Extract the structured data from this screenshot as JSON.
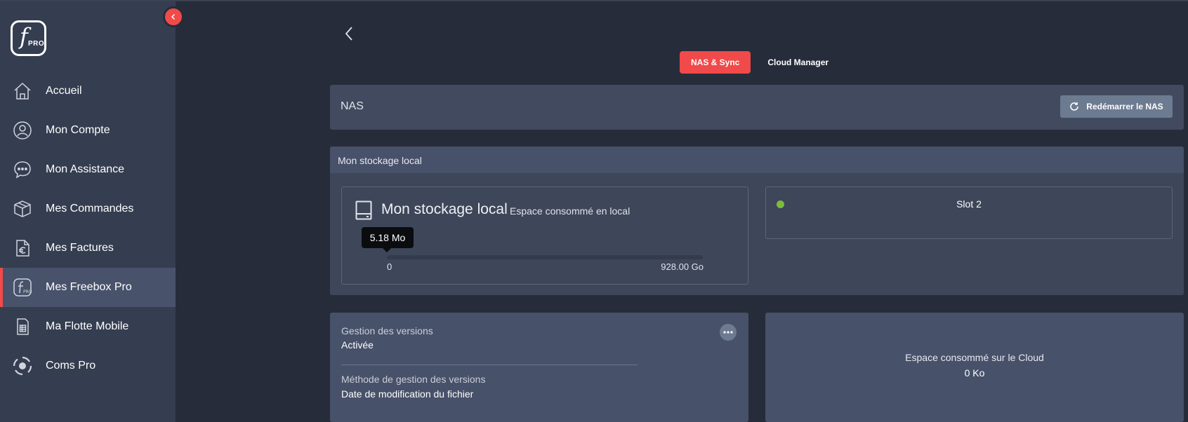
{
  "sidebar": {
    "logo": {
      "letter": "f",
      "sub": "PRO"
    },
    "items": [
      {
        "label": "Accueil",
        "icon": "home-icon",
        "active": false
      },
      {
        "label": "Mon Compte",
        "icon": "user-icon",
        "active": false
      },
      {
        "label": "Mon Assistance",
        "icon": "chat-icon",
        "active": false
      },
      {
        "label": "Mes Commandes",
        "icon": "box-icon",
        "active": false
      },
      {
        "label": "Mes Factures",
        "icon": "euro-document-icon",
        "active": false
      },
      {
        "label": "Mes Freebox Pro",
        "icon": "freebox-pro-icon",
        "active": true
      },
      {
        "label": "Ma Flotte Mobile",
        "icon": "sim-card-icon",
        "active": false
      },
      {
        "label": "Coms Pro",
        "icon": "coms-icon",
        "active": false
      }
    ]
  },
  "tabs": [
    {
      "label": "NAS & Sync",
      "active": true
    },
    {
      "label": "Cloud Manager",
      "active": false
    }
  ],
  "nas": {
    "title": "NAS",
    "restart_label": "Redémarrer le NAS"
  },
  "storage": {
    "header": "Mon stockage local",
    "local": {
      "title": "Mon stockage local",
      "subtitle": "Espace consommé en local",
      "used": "5.18 Mo",
      "used_fraction": 0.0,
      "min": "0",
      "max": "928.00 Go"
    },
    "slot": {
      "label": "Slot 2",
      "status_color": "#7dbb3f"
    }
  },
  "versions": {
    "label1": "Gestion des versions",
    "value1": "Activée",
    "label2": "Méthode de gestion des versions",
    "value2": "Date de modification du fichier"
  },
  "cloud": {
    "label": "Espace consommé sur le Cloud",
    "value": "0 Ko"
  },
  "colors": {
    "accent": "#f04a4a",
    "sidebar_bg": "#353e50",
    "page_bg": "#262c3a",
    "status_ok": "#7dbb3f"
  }
}
